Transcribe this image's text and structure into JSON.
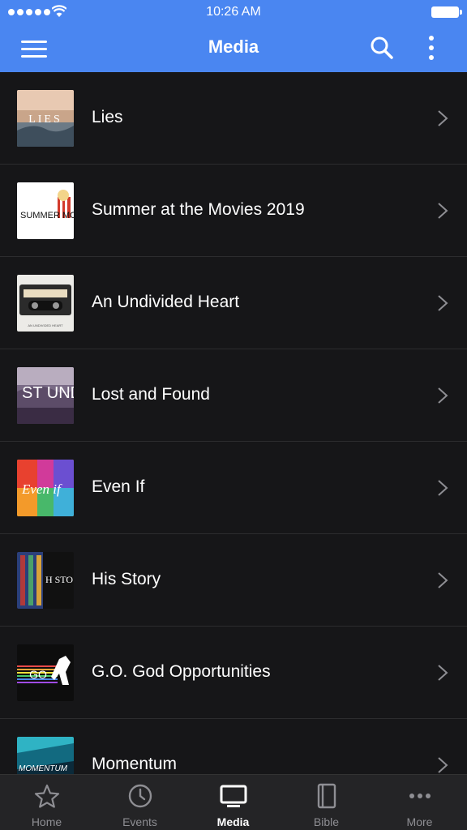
{
  "status_bar": {
    "time": "10:26 AM"
  },
  "header": {
    "title": "Media"
  },
  "media_items": [
    {
      "title": "Lies",
      "thumb_text": "LIES"
    },
    {
      "title": "Summer at the Movies 2019",
      "thumb_text": "SUMMER MOVIES"
    },
    {
      "title": "An Undivided Heart",
      "thumb_text": "AN UNDIVIDED HEART"
    },
    {
      "title": "Lost and Found",
      "thumb_text": "ST UND"
    },
    {
      "title": "Even If",
      "thumb_text": "Even if"
    },
    {
      "title": "His Story",
      "thumb_text": "H STO"
    },
    {
      "title": "G.O. God Opportunities",
      "thumb_text": "GO"
    },
    {
      "title": "Momentum",
      "thumb_text": "MOMENTUM"
    }
  ],
  "tab_bar": {
    "tabs": [
      {
        "label": "Home",
        "icon": "star-icon"
      },
      {
        "label": "Events",
        "icon": "clock-icon"
      },
      {
        "label": "Media",
        "icon": "tv-icon",
        "active": true
      },
      {
        "label": "Bible",
        "icon": "book-icon"
      },
      {
        "label": "More",
        "icon": "ellipsis-icon"
      }
    ]
  },
  "colors": {
    "header": "#4a86f1",
    "background": "#161618",
    "tabbar": "#242426"
  }
}
